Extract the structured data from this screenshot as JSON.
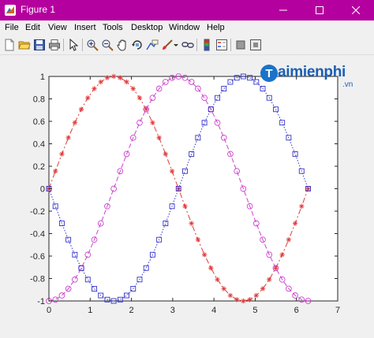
{
  "window": {
    "title": "Figure 1",
    "colors": {
      "titlebar": "#b4009e",
      "background": "#f0f0f0"
    }
  },
  "menu": [
    "File",
    "Edit",
    "View",
    "Insert",
    "Tools",
    "Desktop",
    "Window",
    "Help"
  ],
  "toolbar": {
    "icons": [
      "new-figure-icon",
      "open-file-icon",
      "save-icon",
      "print-icon",
      "pointer-icon",
      "zoom-in-icon",
      "zoom-out-icon",
      "pan-icon",
      "rotate-3d-icon",
      "data-cursor-icon",
      "brush-icon",
      "link-plot-icon",
      "insert-colorbar-icon",
      "insert-legend-icon",
      "hide-plot-tools-icon",
      "show-plot-tools-icon"
    ]
  },
  "watermark": {
    "brand": "aimienphi",
    "suffix": ".vn",
    "mark": "T"
  },
  "chart_data": {
    "type": "line",
    "xlim": [
      0,
      7
    ],
    "ylim": [
      -1,
      1
    ],
    "x_ticks": [
      0,
      1,
      2,
      3,
      4,
      5,
      6,
      7
    ],
    "y_ticks": [
      1,
      0.8,
      0.6,
      0.4,
      0.2,
      0,
      -0.2,
      -0.4,
      -0.6,
      -0.8,
      -1
    ],
    "x_tick_labels": [
      "0",
      "1",
      "2",
      "3",
      "4",
      "5",
      "6",
      "7"
    ],
    "y_tick_labels": [
      "1",
      "0.8",
      "0.6",
      "0.4",
      "0.2",
      "0",
      "-0.2",
      "-0.4",
      "-0.6",
      "-0.8",
      "-1"
    ],
    "grid": false,
    "x_range": [
      0,
      6.283
    ],
    "num_points": 41,
    "series": [
      {
        "function": "sin(x)",
        "color": "#e03c3c",
        "line_style": "dash-dot",
        "marker": "asterisk"
      },
      {
        "function": "-cos(x)",
        "color": "#cc44cc",
        "line_style": "dashed",
        "marker": "circle"
      },
      {
        "function": "-sin(x)",
        "color": "#3333cc",
        "line_style": "dotted",
        "marker": "square"
      }
    ]
  }
}
